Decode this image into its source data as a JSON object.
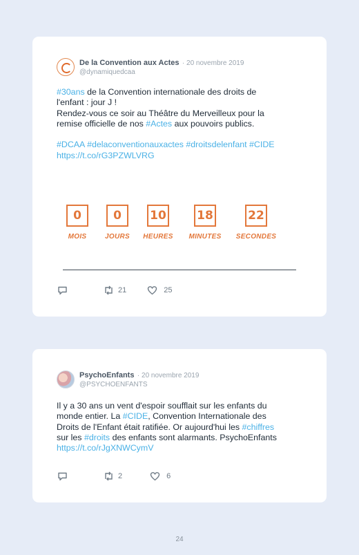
{
  "tweets": [
    {
      "author": "De la Convention aux Actes",
      "date": "· 20 novembre 2019",
      "handle": "@dynamiquedcaa",
      "lines": [
        [
          {
            "t": "#30ans",
            "tag": true
          },
          {
            "t": " de la Convention internationale des droits de"
          }
        ],
        [
          {
            "t": "l'enfant : jour J !"
          }
        ],
        [
          {
            "t": "Rendez-vous ce soir au Théâtre du Merveilleux pour la"
          }
        ],
        [
          {
            "t": "remise officielle de nos "
          },
          {
            "t": "#Actes",
            "tag": true
          },
          {
            "t": " aux pouvoirs publics."
          }
        ],
        [
          {
            "t": ""
          }
        ],
        [
          {
            "t": "#DCAA",
            "tag": true
          },
          {
            "t": " "
          },
          {
            "t": "#delaconventionauxactes",
            "tag": true
          },
          {
            "t": " "
          },
          {
            "t": "#droitsdelenfant",
            "tag": true
          },
          {
            "t": " "
          },
          {
            "t": "#CIDE",
            "tag": true
          }
        ],
        [
          {
            "t": "https://t.co/rG3PZWLVRG",
            "tag": true
          }
        ]
      ],
      "countdown": [
        {
          "value": "0",
          "label": "MOIS"
        },
        {
          "value": "0",
          "label": "JOURS"
        },
        {
          "value": "10",
          "label": "HEURES"
        },
        {
          "value": "18",
          "label": "MINUTES"
        },
        {
          "value": "22",
          "label": "SECONDES"
        }
      ],
      "retweets": "21",
      "likes": "25"
    },
    {
      "author": "PsychoEnfants",
      "date": "· 20 novembre 2019",
      "handle": "@PSYCHOENFANTS",
      "lines": [
        [
          {
            "t": "Il y a 30 ans un vent d'espoir soufflait sur les enfants du"
          }
        ],
        [
          {
            "t": "monde entier. La "
          },
          {
            "t": "#CIDE",
            "tag": true
          },
          {
            "t": ", Convention Internationale des"
          }
        ],
        [
          {
            "t": "Droits de l'Enfant était ratifiée. Or aujourd'hui les "
          },
          {
            "t": "#chiffres",
            "tag": true
          }
        ],
        [
          {
            "t": "sur les "
          },
          {
            "t": "#droits",
            "tag": true
          },
          {
            "t": " des enfants sont alarmants. PsychoEnfants"
          }
        ],
        [
          {
            "t": "https://t.co/rJgXNWCymV",
            "tag": true
          }
        ]
      ],
      "retweets": "2",
      "likes": "6"
    }
  ],
  "page_number": "24",
  "colors": {
    "accent": "#e3773a",
    "hashtag": "#4ab1e6",
    "background": "#e6ecf7"
  },
  "icons": [
    "reply-icon",
    "retweet-icon",
    "like-icon"
  ]
}
